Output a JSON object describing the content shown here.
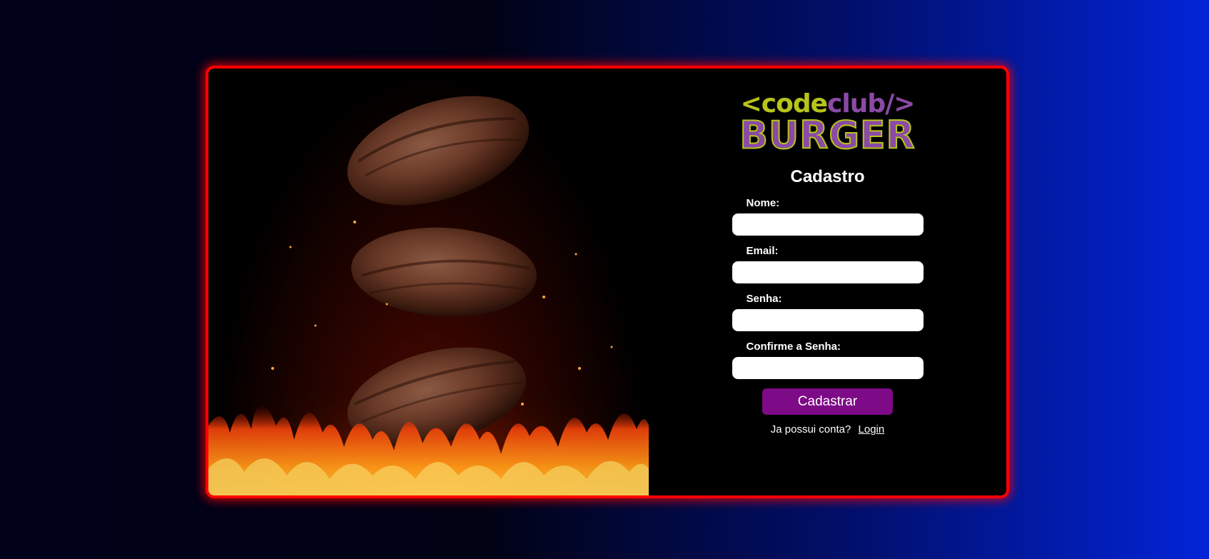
{
  "brand": {
    "logo_left": "<code",
    "logo_right": "club/>",
    "logo_bottom": "BURGER",
    "accent_green": "#b7c41a",
    "accent_purple": "#8a4aa6"
  },
  "hero": {
    "image": "burger-patties-over-fire"
  },
  "form": {
    "title": "Cadastro",
    "fields": {
      "name": {
        "label": "Nome:",
        "value": ""
      },
      "email": {
        "label": "Email:",
        "value": ""
      },
      "password": {
        "label": "Senha:",
        "value": ""
      },
      "confirm": {
        "label": "Confirme a Senha:",
        "value": ""
      }
    },
    "submit_label": "Cadastrar",
    "login_prompt": "Ja possui conta?",
    "login_link": "Login"
  },
  "colors": {
    "card_border": "#ff0000",
    "submit_bg": "#7d0a86"
  }
}
